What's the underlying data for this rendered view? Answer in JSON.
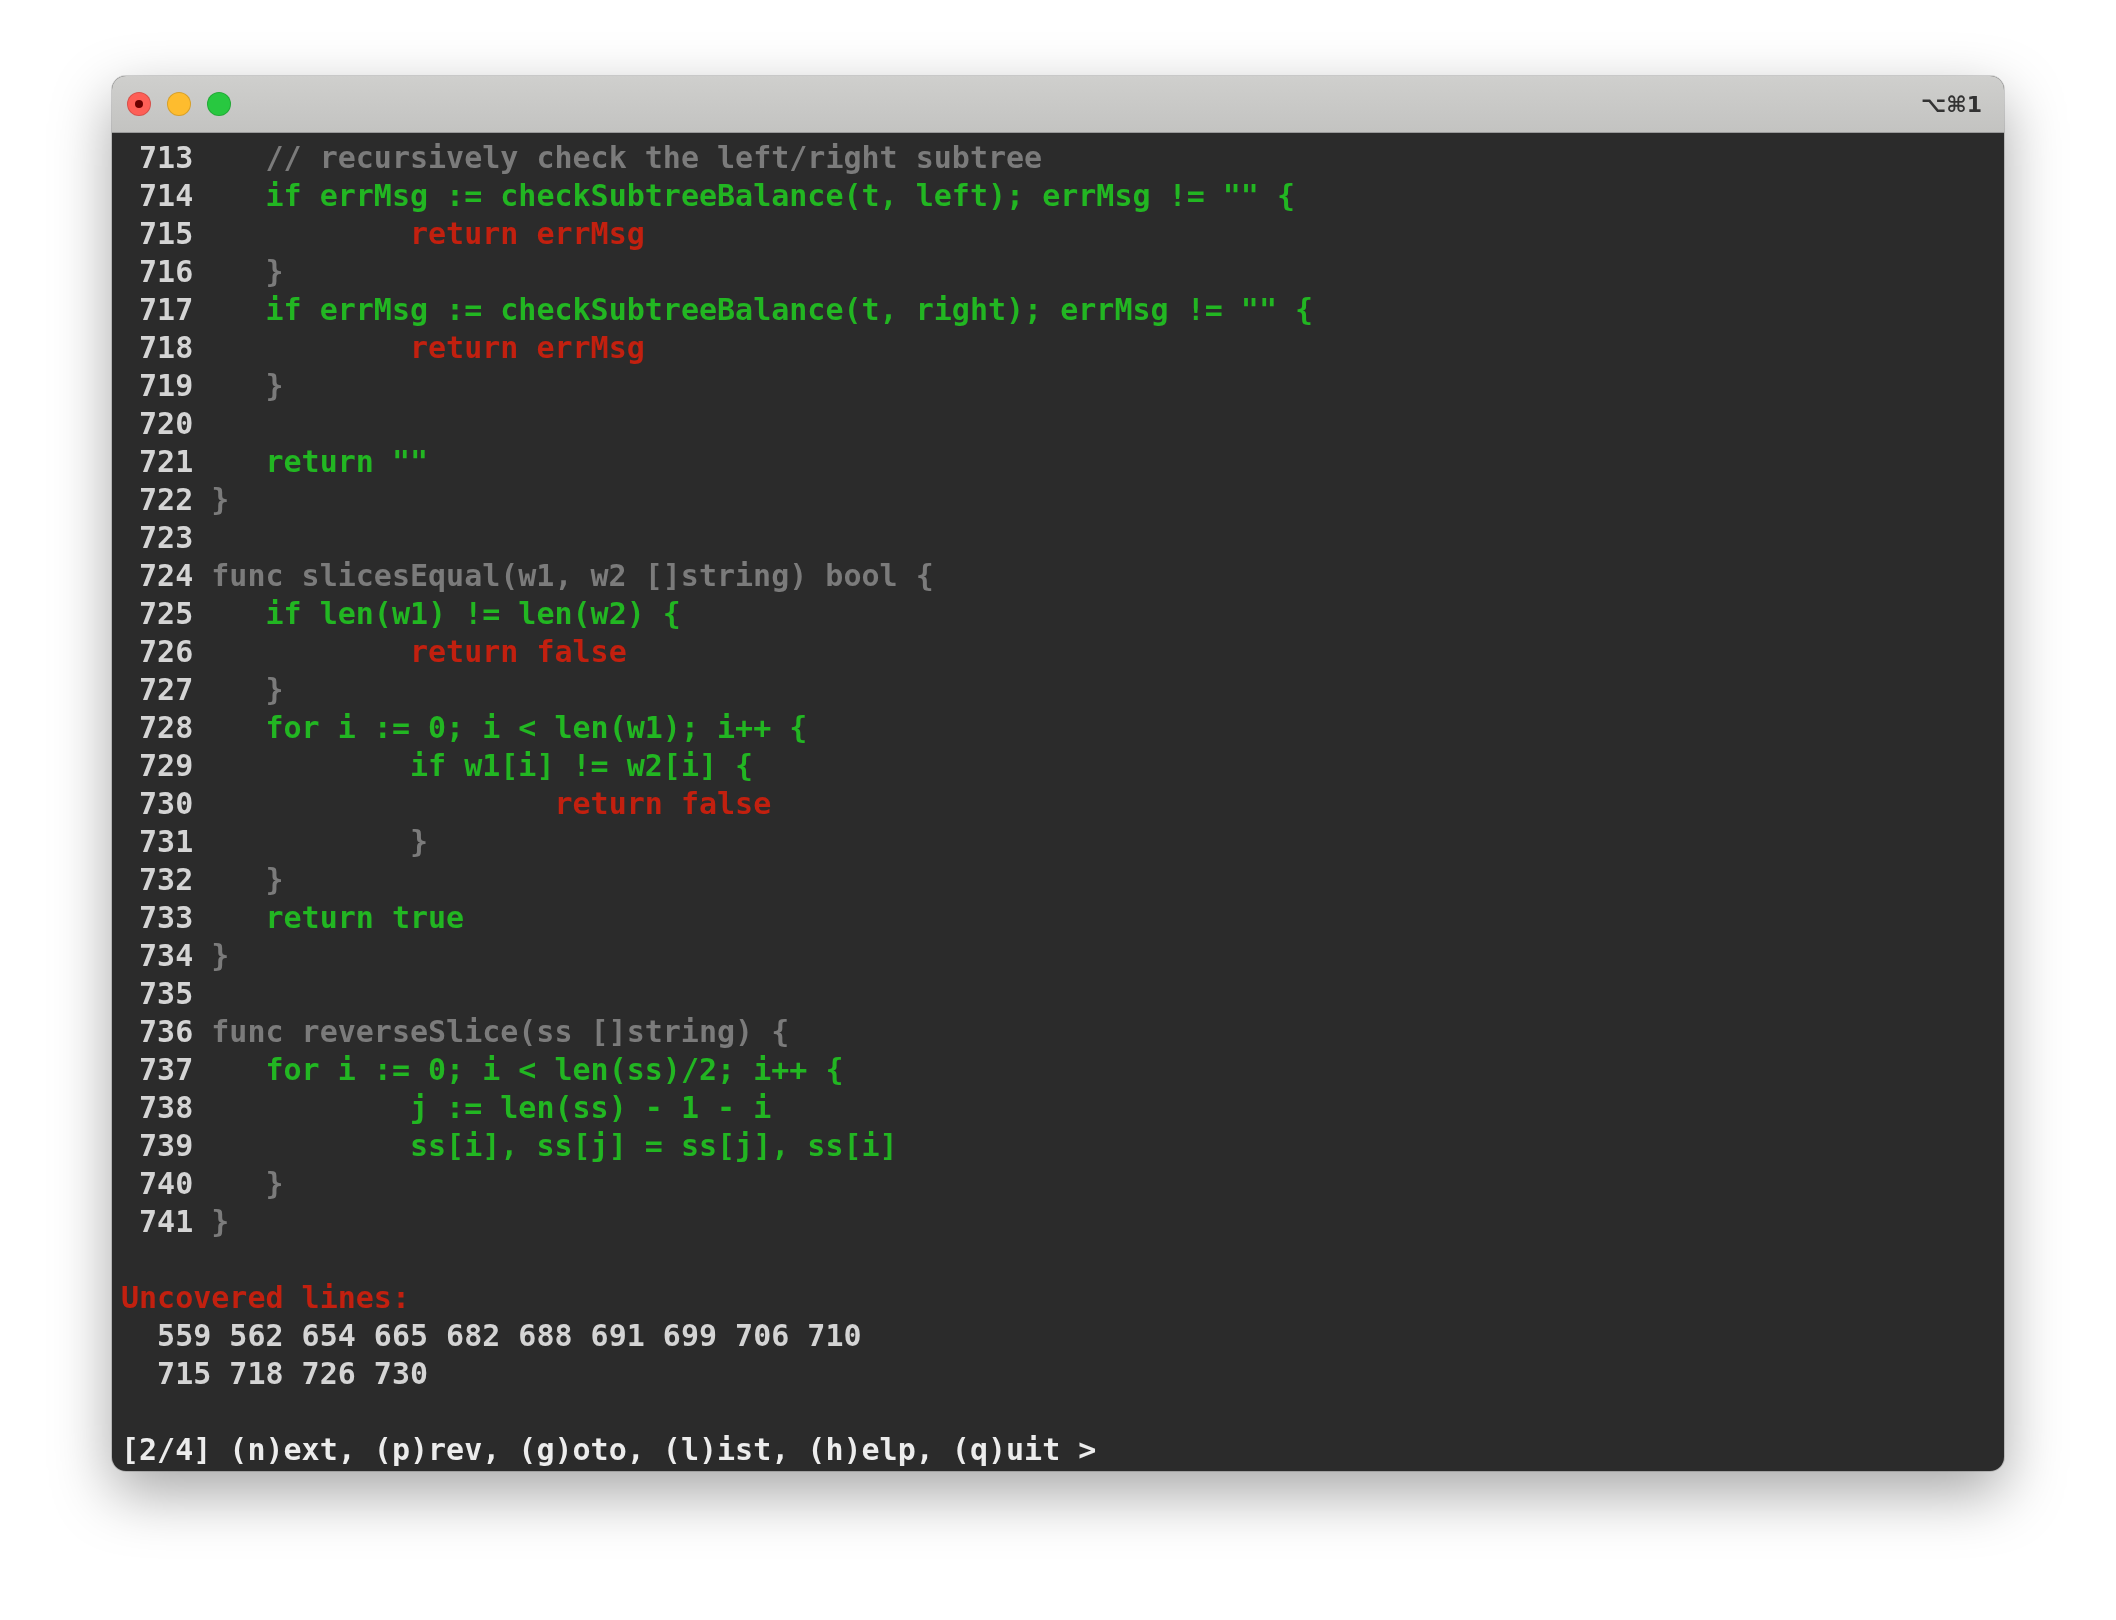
{
  "window": {
    "shortcut": "⌥⌘1"
  },
  "lines": [
    {
      "number": "713",
      "kind": "neutral",
      "code": "\t// recursively check the left/right subtree"
    },
    {
      "number": "714",
      "kind": "covered",
      "code": "\tif errMsg := checkSubtreeBalance(t, left); errMsg != \"\" {"
    },
    {
      "number": "715",
      "kind": "uncovered",
      "code": "\t\treturn errMsg"
    },
    {
      "number": "716",
      "kind": "neutral",
      "code": "\t}"
    },
    {
      "number": "717",
      "kind": "covered",
      "code": "\tif errMsg := checkSubtreeBalance(t, right); errMsg != \"\" {"
    },
    {
      "number": "718",
      "kind": "uncovered",
      "code": "\t\treturn errMsg"
    },
    {
      "number": "719",
      "kind": "neutral",
      "code": "\t}"
    },
    {
      "number": "720"
    },
    {
      "number": "721",
      "kind": "covered",
      "code": "\treturn \"\""
    },
    {
      "number": "722",
      "kind": "neutral",
      "code": "}"
    },
    {
      "number": "723"
    },
    {
      "number": "724",
      "kind": "neutral",
      "code": "func slicesEqual(w1, w2 []string) bool {"
    },
    {
      "number": "725",
      "kind": "covered",
      "code": "\tif len(w1) != len(w2) {"
    },
    {
      "number": "726",
      "kind": "uncovered",
      "code": "\t\treturn false"
    },
    {
      "number": "727",
      "kind": "neutral",
      "code": "\t}"
    },
    {
      "number": "728",
      "kind": "covered",
      "code": "\tfor i := 0; i < len(w1); i++ {"
    },
    {
      "number": "729",
      "kind": "covered",
      "code": "\t\tif w1[i] != w2[i] {"
    },
    {
      "number": "730",
      "kind": "uncovered",
      "code": "\t\t\treturn false"
    },
    {
      "number": "731",
      "kind": "neutral",
      "code": "\t\t}"
    },
    {
      "number": "732",
      "kind": "neutral",
      "code": "\t}"
    },
    {
      "number": "733",
      "kind": "covered",
      "code": "\treturn true"
    },
    {
      "number": "734",
      "kind": "neutral",
      "code": "}"
    },
    {
      "number": "735"
    },
    {
      "number": "736",
      "kind": "neutral",
      "code": "func reverseSlice(ss []string) {"
    },
    {
      "number": "737",
      "kind": "covered",
      "code": "\tfor i := 0; i < len(ss)/2; i++ {"
    },
    {
      "number": "738",
      "kind": "covered",
      "code": "\t\tj := len(ss) - 1 - i"
    },
    {
      "number": "739",
      "kind": "covered",
      "code": "\t\tss[i], ss[j] = ss[j], ss[i]"
    },
    {
      "number": "740",
      "kind": "neutral",
      "code": "\t}"
    },
    {
      "number": "741",
      "kind": "neutral",
      "code": "}"
    }
  ],
  "uncovered": {
    "heading": "Uncovered lines:",
    "rows": [
      "559 562 654 665 682 688 691 699 706 710",
      "715 718 726 730"
    ]
  },
  "prompt": "[2/4] (n)ext, (p)rev, (g)oto, (l)ist, (h)elp, (q)uit >"
}
